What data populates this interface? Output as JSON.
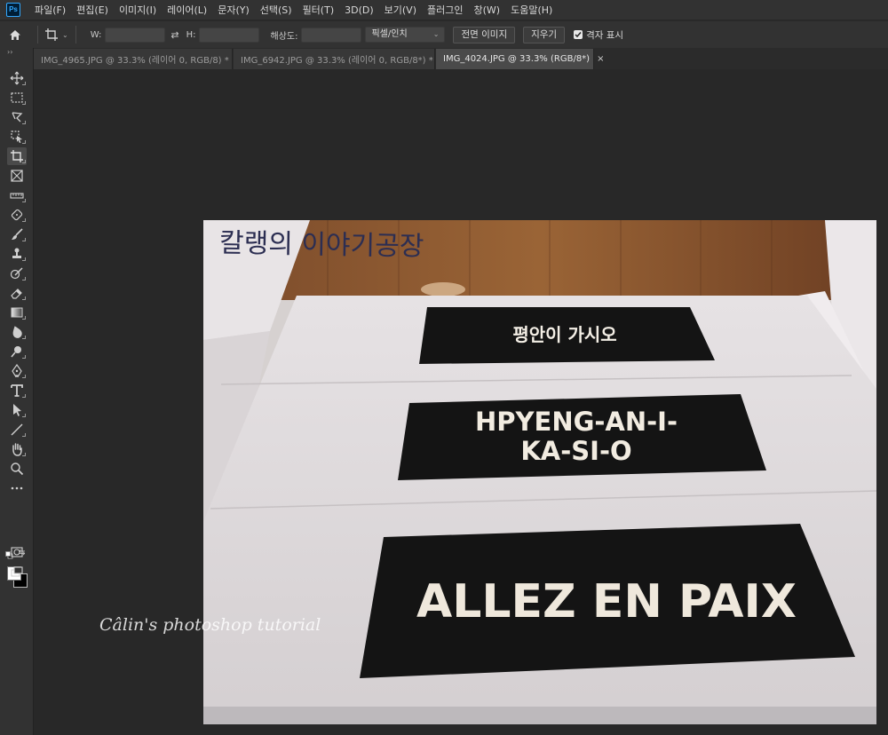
{
  "menubar": {
    "logo": "Ps",
    "items": [
      "파일(F)",
      "편집(E)",
      "이미지(I)",
      "레이어(L)",
      "문자(Y)",
      "선택(S)",
      "필터(T)",
      "3D(D)",
      "보기(V)",
      "플러그인",
      "창(W)",
      "도움말(H)"
    ]
  },
  "options": {
    "w_label": "W:",
    "h_label": "H:",
    "w_value": "",
    "h_value": "",
    "resolution_label": "해상도:",
    "resolution_value": "",
    "unit_select": "픽셀/인치",
    "front_image_button": "전면 이미지",
    "clear_button": "지우기",
    "grid_label": "격자 표시",
    "grid_checked": true
  },
  "tabs": [
    {
      "label": "IMG_4965.JPG @ 33.3% (레이어 0, RGB/8) *",
      "active": false
    },
    {
      "label": "IMG_6942.JPG @ 33.3% (레이어 0, RGB/8*) *",
      "active": false
    },
    {
      "label": "IMG_4024.JPG @ 33.3% (RGB/8*)",
      "active": true
    }
  ],
  "tools": [
    {
      "name": "move-tool",
      "icon": "move-icon"
    },
    {
      "name": "marquee-tool",
      "icon": "marquee-icon"
    },
    {
      "name": "lasso-tool",
      "icon": "lasso-icon"
    },
    {
      "name": "object-select-tool",
      "icon": "object-select-icon"
    },
    {
      "name": "crop-tool",
      "icon": "crop-icon",
      "active": true
    },
    {
      "name": "frame-tool",
      "icon": "frame-icon"
    },
    {
      "name": "ruler-tool",
      "icon": "ruler-icon"
    },
    {
      "name": "spot-heal-tool",
      "icon": "bandage-icon"
    },
    {
      "name": "brush-tool",
      "icon": "brush-icon"
    },
    {
      "name": "stamp-tool",
      "icon": "stamp-icon"
    },
    {
      "name": "history-brush-tool",
      "icon": "history-brush-icon"
    },
    {
      "name": "eraser-tool",
      "icon": "eraser-icon"
    },
    {
      "name": "gradient-tool",
      "icon": "gradient-icon"
    },
    {
      "name": "blur-tool",
      "icon": "blur-icon"
    },
    {
      "name": "dodge-tool",
      "icon": "dodge-icon"
    },
    {
      "name": "pen-tool",
      "icon": "pen-icon"
    },
    {
      "name": "type-tool",
      "icon": "type-icon"
    },
    {
      "name": "path-select-tool",
      "icon": "path-select-icon"
    },
    {
      "name": "line-tool",
      "icon": "line-icon"
    },
    {
      "name": "hand-tool",
      "icon": "hand-icon"
    },
    {
      "name": "zoom-tool",
      "icon": "zoom-icon"
    },
    {
      "name": "more-tools",
      "icon": "ellipsis-icon"
    }
  ],
  "colors": {
    "foreground": "#ffffff",
    "background": "#000000",
    "accent": "#31a8ff"
  },
  "photo": {
    "handwriting": "칼랭의 이야기공장",
    "mat1_text": "평안이 가시오",
    "mat2_line1": "HPYENG-AN-I-",
    "mat2_line2": "KA-SI-O",
    "mat3_text": "ALLEZ EN PAIX",
    "watermark": "Câlin's photoshop tutorial"
  }
}
